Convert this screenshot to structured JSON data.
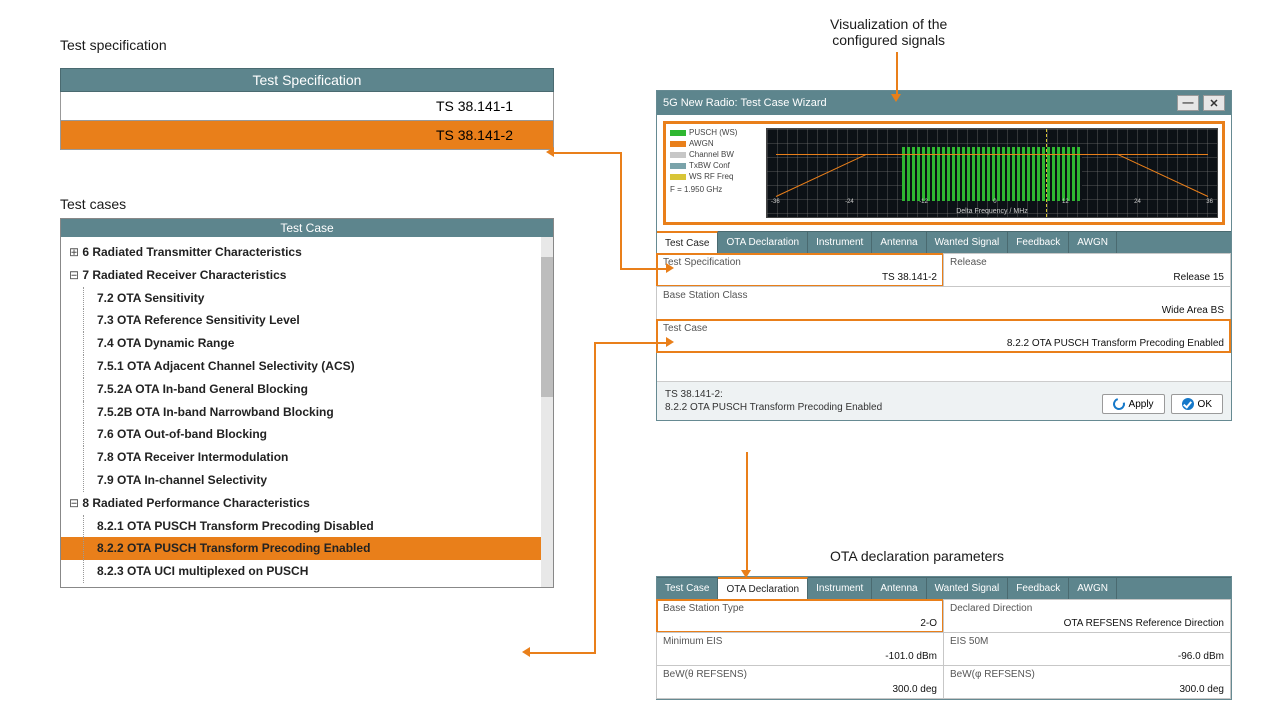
{
  "headings": {
    "spec": "Test specification",
    "cases": "Test cases",
    "viz": "Visualization of the\nconfigured signals",
    "ota": "OTA declaration parameters"
  },
  "spec": {
    "header": "Test Specification",
    "rows": [
      "TS 38.141-1",
      "TS 38.141-2"
    ],
    "selected_index": 1
  },
  "cases": {
    "header": "Test Case",
    "groups": [
      {
        "sym": "⊞",
        "label": "6  Radiated Transmitter Characteristics",
        "items": []
      },
      {
        "sym": "⊟",
        "label": "7  Radiated Receiver Characteristics",
        "items": [
          "7.2  OTA Sensitivity",
          "7.3  OTA Reference Sensitivity Level",
          "7.4  OTA Dynamic Range",
          "7.5.1  OTA Adjacent Channel Selectivity (ACS)",
          "7.5.2A  OTA In-band General Blocking",
          "7.5.2B  OTA In-band Narrowband Blocking",
          "7.6  OTA Out-of-band Blocking",
          "7.8  OTA Receiver Intermodulation",
          "7.9  OTA In-channel Selectivity"
        ]
      },
      {
        "sym": "⊟",
        "label": "8  Radiated Performance Characteristics",
        "items": [
          "8.2.1  OTA PUSCH Transform Precoding Disabled",
          "8.2.2  OTA PUSCH Transform Precoding Enabled",
          "8.2.3  OTA UCI multiplexed on PUSCH"
        ],
        "selected_item_index": 1
      }
    ]
  },
  "wizard": {
    "title": "5G New Radio: Test Case Wizard",
    "tabs": [
      "Test Case",
      "OTA Declaration",
      "Instrument",
      "Antenna",
      "Wanted Signal",
      "Feedback",
      "AWGN"
    ],
    "active_tab_index": 0,
    "legend": [
      {
        "color": "#2fb731",
        "label": "PUSCH (WS)"
      },
      {
        "color": "#e97f1a",
        "label": "AWGN"
      },
      {
        "color": "#c7c7c7",
        "label": "Channel BW"
      },
      {
        "color": "#7aa3aa",
        "label": "TxBW Conf"
      },
      {
        "color": "#d8c537",
        "label": "WS RF Freq"
      }
    ],
    "freq_note": "F = 1.950 GHz",
    "xlabel": "Delta Frequency / MHz",
    "fields": {
      "spec": {
        "label": "Test Specification",
        "value": "TS 38.141-2"
      },
      "release": {
        "label": "Release",
        "value": "Release 15"
      },
      "bsclass": {
        "label": "Base Station Class",
        "value": "Wide Area BS"
      },
      "tcase": {
        "label": "Test Case",
        "value": "8.2.2 OTA PUSCH Transform Precoding Enabled"
      }
    },
    "footer": {
      "line1": "TS 38.141-2:",
      "line2": "8.2.2 OTA PUSCH Transform Precoding Enabled",
      "apply": "Apply",
      "ok": "OK"
    }
  },
  "ota": {
    "tabs_active_index": 1,
    "fields": {
      "bstype": {
        "label": "Base Station Type",
        "value": "2-O"
      },
      "decdir": {
        "label": "Declared Direction",
        "value": "OTA REFSENS Reference Direction"
      },
      "mineis": {
        "label": "Minimum EIS",
        "value": "-101.0 dBm"
      },
      "eis50": {
        "label": "EIS 50M",
        "value": "-96.0 dBm"
      },
      "bewth": {
        "label": "BeW(θ REFSENS)",
        "value": "300.0 deg"
      },
      "bewph": {
        "label": "BeW(φ REFSENS)",
        "value": "300.0 deg"
      }
    }
  }
}
